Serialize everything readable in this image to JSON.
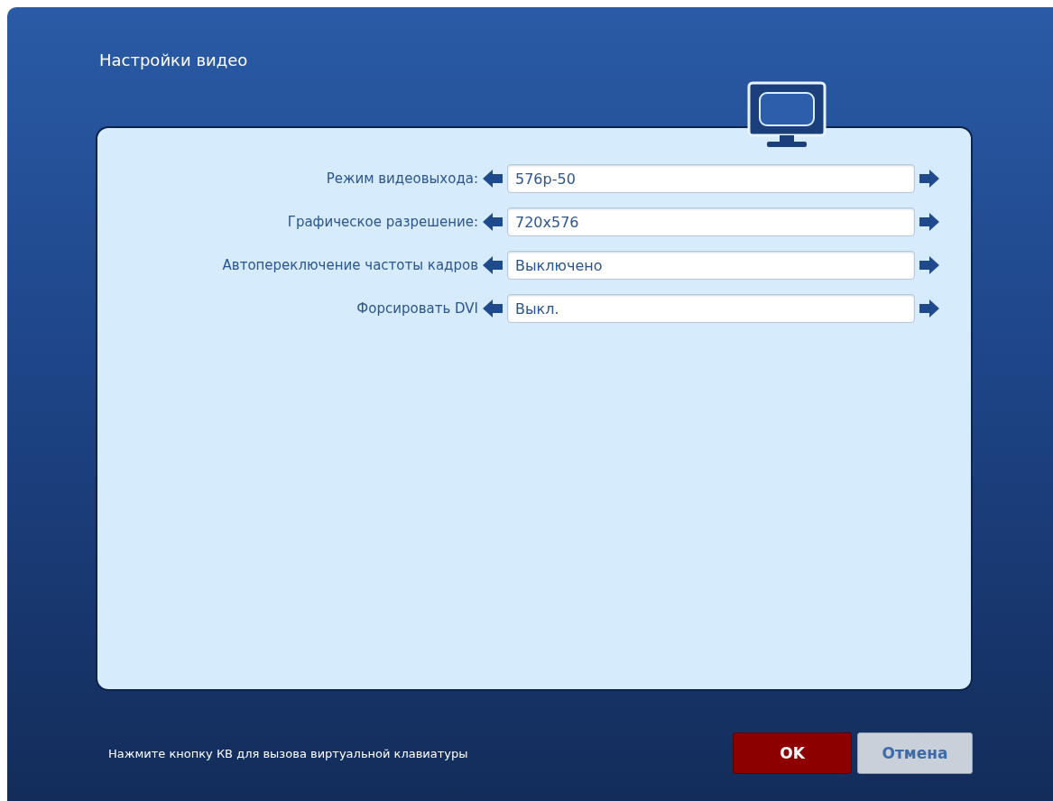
{
  "window": {
    "title": "Настройки видео"
  },
  "settings": [
    {
      "label": "Режим видеовыхода:",
      "value": "576p-50"
    },
    {
      "label": "Графическое разрешение:",
      "value": "720x576"
    },
    {
      "label": "Автопереключение частоты кадров",
      "value": "Выключено"
    },
    {
      "label": "Форсировать DVI",
      "value": "Выкл."
    }
  ],
  "hint": "Нажмите кнопку КВ для вызова виртуальной клавиатуры",
  "buttons": [
    {
      "label": "OK",
      "kind": "primary"
    },
    {
      "label": "Отмена",
      "kind": "secondary"
    }
  ]
}
